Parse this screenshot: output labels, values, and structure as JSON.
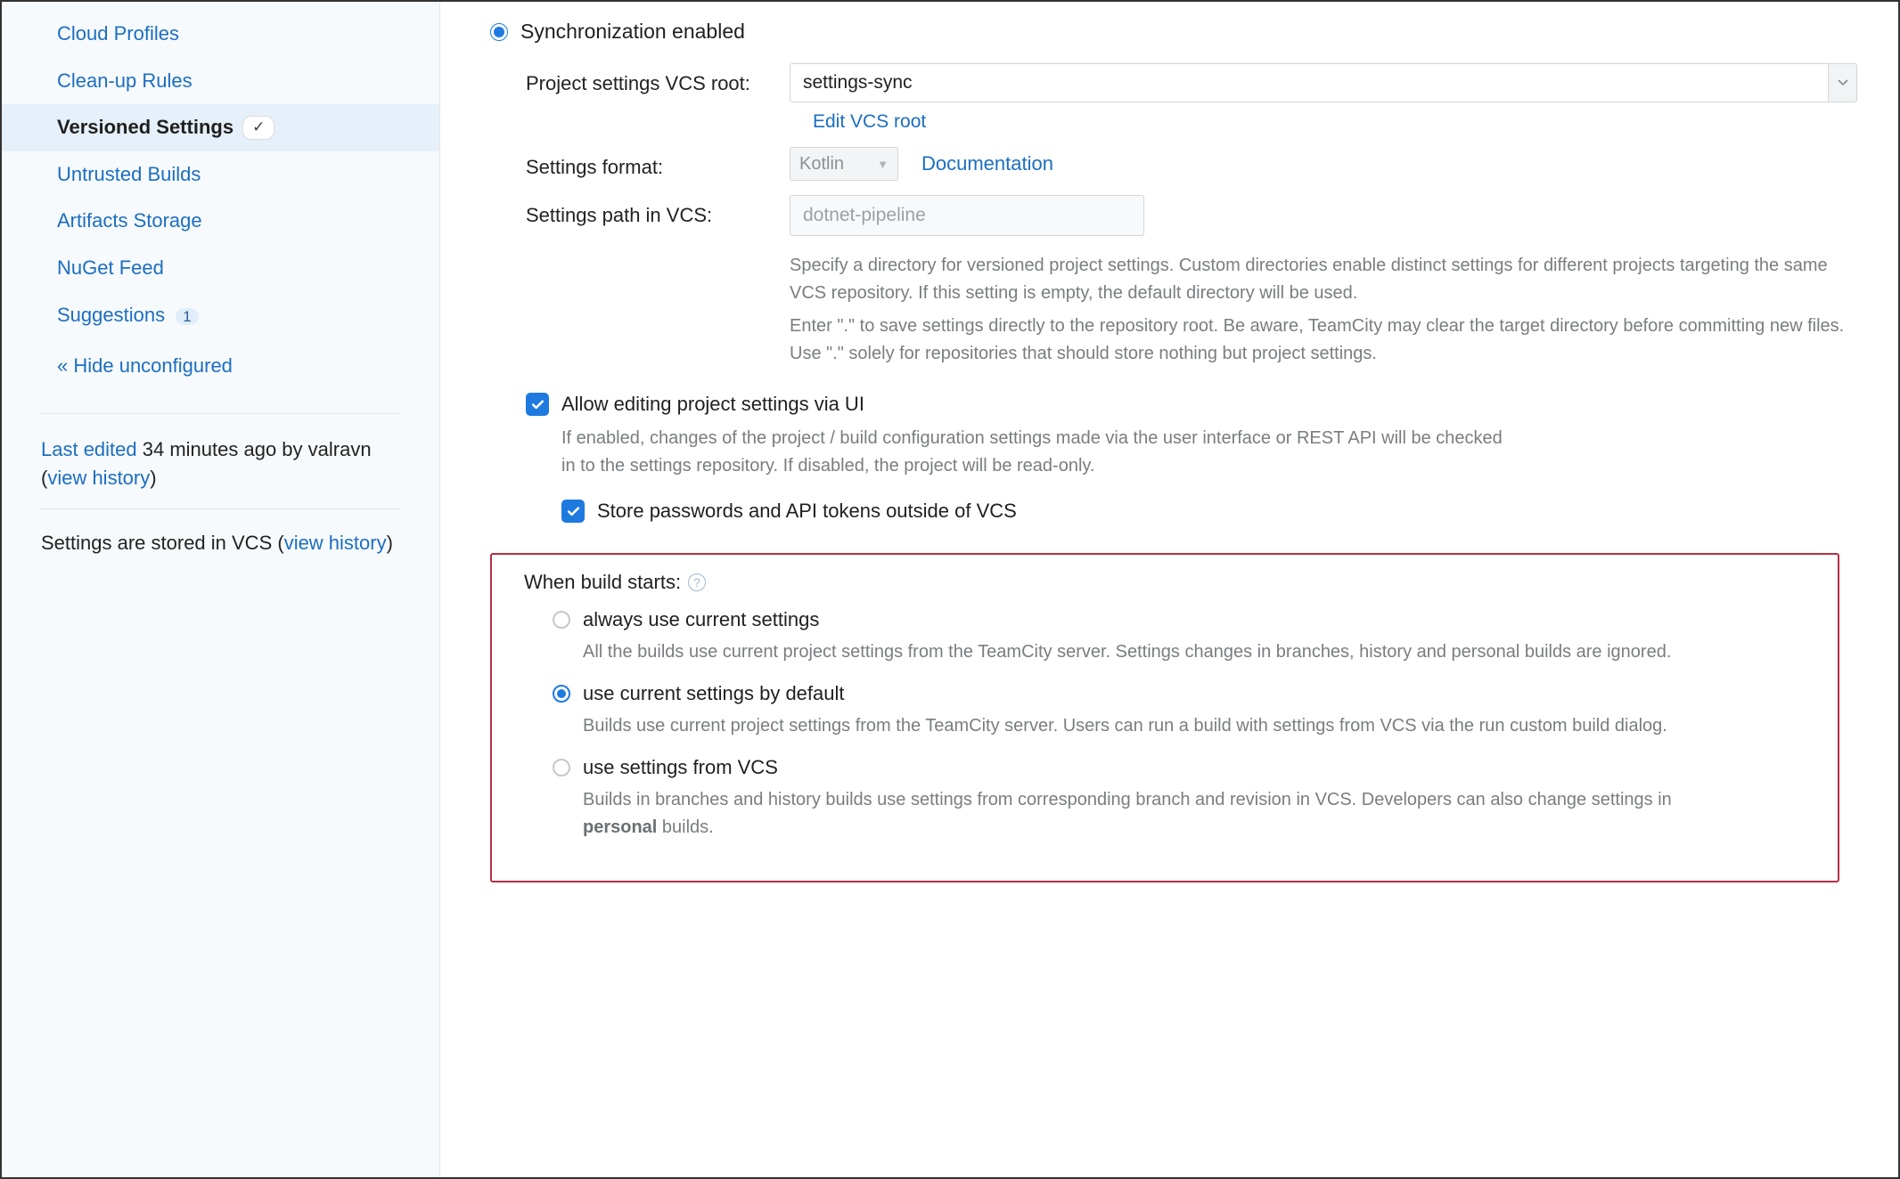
{
  "sidebar": {
    "items": [
      {
        "label": "Cloud Profiles"
      },
      {
        "label": "Clean-up Rules"
      },
      {
        "label": "Versioned Settings",
        "active": true
      },
      {
        "label": "Untrusted Builds"
      },
      {
        "label": "Artifacts Storage"
      },
      {
        "label": "NuGet Feed"
      },
      {
        "label": "Suggestions",
        "badge": "1"
      }
    ],
    "hide_unconfigured": "« Hide unconfigured",
    "last_edited_prefix": "Last edited",
    "last_edited_time": " 34 minutes ago by valravn  (",
    "view_history": "view history",
    "close_paren": ")",
    "stored_in_vcs_prefix": "Settings are stored in VCS (",
    "stored_in_vcs_close": ")"
  },
  "main": {
    "sync_enabled": "Synchronization enabled",
    "vcs_root_label": "Project settings VCS root:",
    "vcs_root_value": "settings-sync",
    "edit_vcs_root": "Edit VCS root",
    "settings_format_label": "Settings format:",
    "settings_format_value": "Kotlin",
    "documentation": "Documentation",
    "settings_path_label": "Settings path in VCS:",
    "settings_path_placeholder": "dotnet-pipeline",
    "settings_path_help1": "Specify a directory for versioned project settings. Custom directories enable distinct settings for different projects targeting the same VCS repository. If this setting is empty, the default directory will be used.",
    "settings_path_help2": "Enter \".\" to save settings directly to the repository root. Be aware, TeamCity may clear the target directory before committing new files. Use \".\" solely for repositories that should store nothing but project settings.",
    "allow_editing_label": "Allow editing project settings via UI",
    "allow_editing_desc": "If enabled, changes of the project / build configuration settings made via the user interface or REST API will be checked in to the settings repository. If disabled, the project will be read-only.",
    "store_passwords_label": "Store passwords and API tokens outside of VCS",
    "when_build_starts": "When build starts:",
    "opt1_label": "always use current settings",
    "opt1_desc": "All the builds use current project settings from the TeamCity server. Settings changes in branches, history and personal builds are ignored.",
    "opt2_label": "use current settings by default",
    "opt2_desc": "Builds use current project settings from the TeamCity server. Users can run a build with settings from VCS via the run custom build dialog.",
    "opt3_label": "use settings from VCS",
    "opt3_desc_pre": "Builds in branches and history builds use settings from corresponding branch and revision in VCS. Developers can also change settings in ",
    "opt3_desc_bold": "personal",
    "opt3_desc_post": " builds."
  }
}
